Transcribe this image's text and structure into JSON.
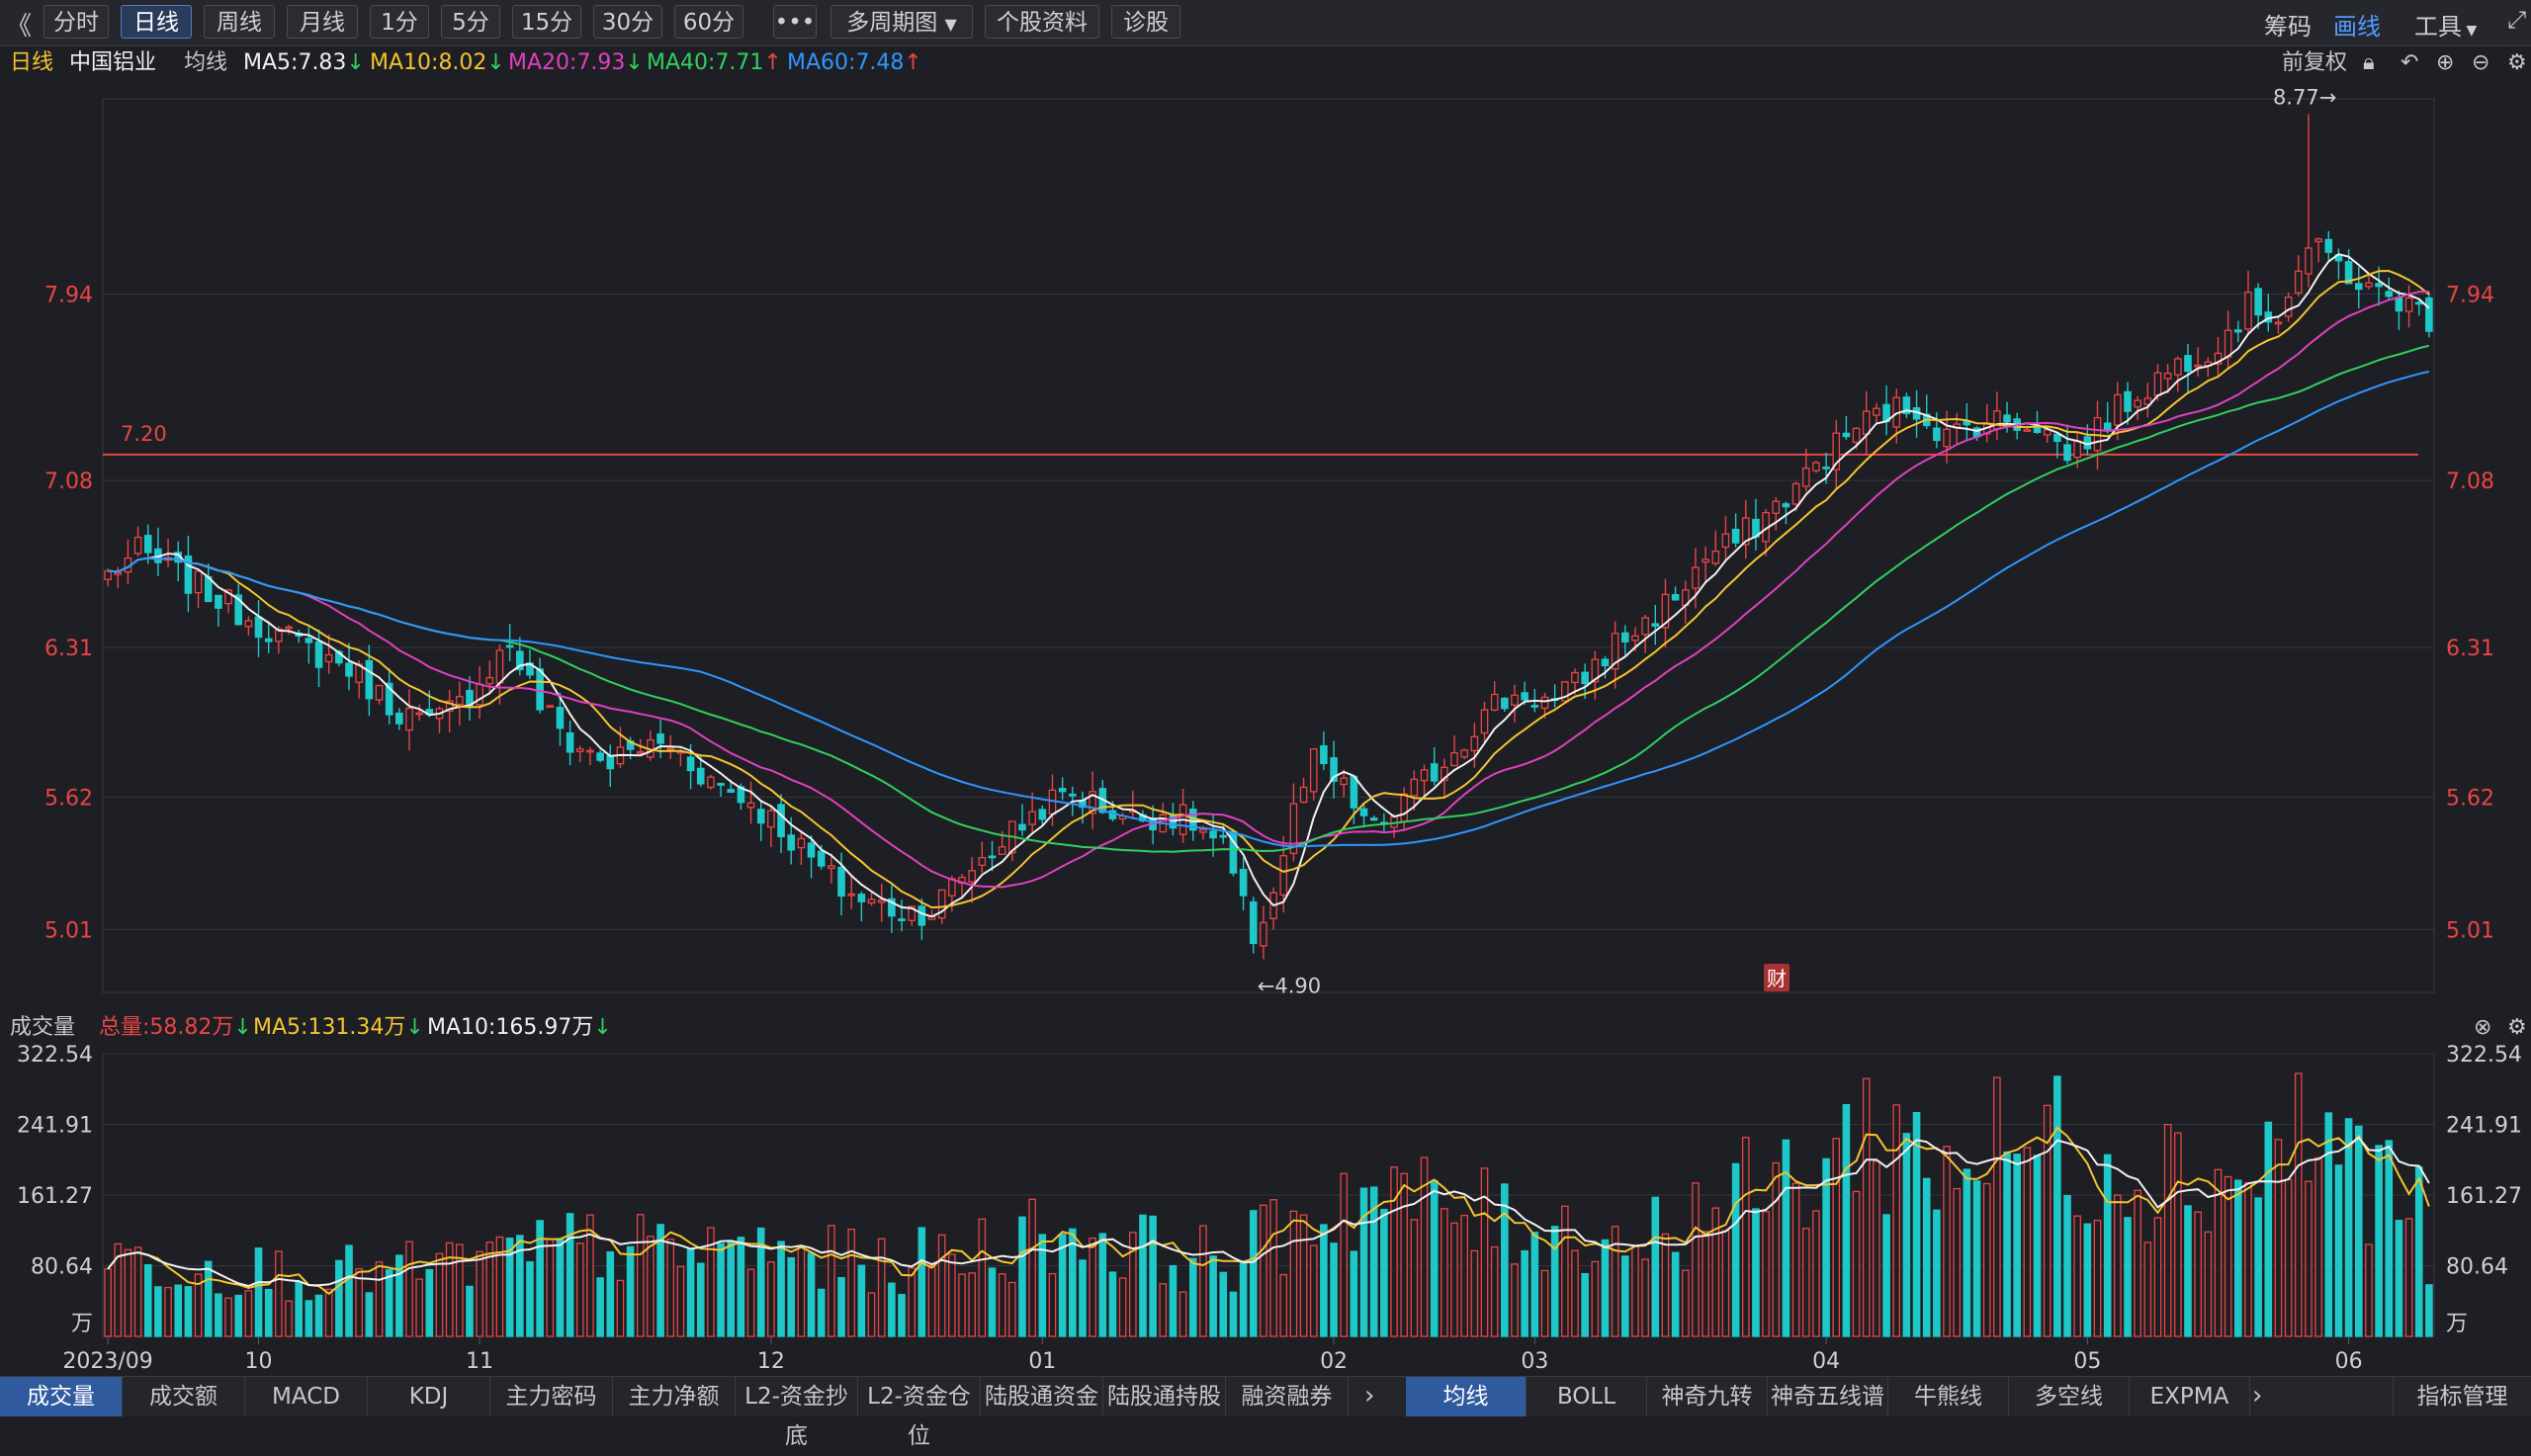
{
  "toolbar": {
    "back_icon": "double-chevron-left-icon",
    "periods": [
      "分时",
      "日线",
      "周线",
      "月线",
      "1分",
      "5分",
      "15分",
      "30分",
      "60分"
    ],
    "active_period": "日线",
    "more_label": "•••",
    "multi_period": "多周期图",
    "stock_info": "个股资料",
    "diagnose": "诊股",
    "right_items": [
      "筹码",
      "画线",
      "工具"
    ],
    "right_active": "画线",
    "expand_icon": "expand-icon"
  },
  "legend": {
    "period": "日线",
    "stock": "中国铝业",
    "ma_label": "均线",
    "ma_items": [
      {
        "text": "MA5:7.83",
        "dir": "down",
        "color": "#f0f0f0"
      },
      {
        "text": "MA10:8.02",
        "dir": "down",
        "color": "#f4c430"
      },
      {
        "text": "MA20:7.93",
        "dir": "down",
        "color": "#e040c0"
      },
      {
        "text": "MA40:7.71",
        "dir": "up",
        "color": "#30d060"
      },
      {
        "text": "MA60:7.48",
        "dir": "up",
        "color": "#2f96ff"
      }
    ],
    "adjust": "前复权",
    "lock_icon": "lock-icon",
    "undo_icon": "undo-icon",
    "zoom_in_icon": "zoom-in-icon",
    "zoom_out_icon": "zoom-out-icon",
    "settings_icon": "gear-icon"
  },
  "vol_legend": {
    "name": "成交量",
    "total": "总量:58.82万",
    "ma5": "MA5:131.34万",
    "ma10": "MA10:165.97万",
    "close_icon": "close-icon",
    "settings_icon": "gear-icon"
  },
  "annotations": {
    "high": "8.77→",
    "low": "←4.90",
    "hline": "7.20",
    "fin_badge": "财"
  },
  "colors": {
    "up": "#e84545",
    "down": "#1fc8c8",
    "ma5": "#f0f0f0",
    "ma10": "#f4c430",
    "ma20": "#e040c0",
    "ma40": "#30d060",
    "ma60": "#2f96ff",
    "hline": "#e84545"
  },
  "bottom_tabs_left": [
    "成交量",
    "成交额",
    "MACD",
    "KDJ",
    "主力密码",
    "主力净额",
    "L2-资金抄底",
    "L2-资金仓位",
    "陆股通资金",
    "陆股通持股",
    "融资融券"
  ],
  "bottom_tabs_right": [
    "均线",
    "BOLL",
    "神奇九转",
    "神奇五线谱",
    "牛熊线",
    "多空线",
    "EXPMA"
  ],
  "bottom_more_icon": "chevron-right-icon",
  "indicator_manage": "指标管理",
  "chart_data": [
    {
      "type": "candlestick",
      "title": "中国铝业 日线",
      "y_ticks": [
        "7.94",
        "7.08",
        "6.31",
        "5.62",
        "5.01"
      ],
      "ylim": [
        4.72,
        8.84
      ],
      "x_ticks": [
        "2023/09",
        "10",
        "11",
        "12",
        "01",
        "02",
        "03",
        "04",
        "05",
        "06"
      ],
      "x_tick_index": [
        0,
        15,
        37,
        66,
        93,
        122,
        142,
        171,
        197,
        223
      ],
      "grid": true,
      "horizontal_line": 7.2,
      "high_mark": {
        "value": 8.77,
        "index": 219
      },
      "low_mark": {
        "value": 4.9,
        "index": 114
      },
      "keypoints": [
        [
          0,
          6.65
        ],
        [
          3,
          6.75
        ],
        [
          8,
          6.62
        ],
        [
          14,
          6.45
        ],
        [
          19,
          6.32
        ],
        [
          24,
          6.22
        ],
        [
          28,
          6.05
        ],
        [
          32,
          5.95
        ],
        [
          35,
          6.05
        ],
        [
          38,
          6.22
        ],
        [
          40,
          6.33
        ],
        [
          43,
          6.05
        ],
        [
          46,
          5.87
        ],
        [
          50,
          5.78
        ],
        [
          53,
          5.85
        ],
        [
          56,
          5.86
        ],
        [
          60,
          5.7
        ],
        [
          64,
          5.6
        ],
        [
          67,
          5.48
        ],
        [
          70,
          5.33
        ],
        [
          73,
          5.2
        ],
        [
          76,
          5.13
        ],
        [
          79,
          5.1
        ],
        [
          82,
          5.1
        ],
        [
          85,
          5.26
        ],
        [
          89,
          5.42
        ],
        [
          93,
          5.58
        ],
        [
          96,
          5.64
        ],
        [
          99,
          5.58
        ],
        [
          102,
          5.52
        ],
        [
          105,
          5.55
        ],
        [
          108,
          5.5
        ],
        [
          111,
          5.38
        ],
        [
          113,
          5.1
        ],
        [
          114,
          4.98
        ],
        [
          116,
          5.18
        ],
        [
          118,
          5.55
        ],
        [
          120,
          5.78
        ],
        [
          123,
          5.65
        ],
        [
          126,
          5.46
        ],
        [
          129,
          5.6
        ],
        [
          132,
          5.74
        ],
        [
          135,
          5.9
        ],
        [
          138,
          6.05
        ],
        [
          141,
          6.1
        ],
        [
          144,
          6.05
        ],
        [
          147,
          6.18
        ],
        [
          150,
          6.33
        ],
        [
          153,
          6.42
        ],
        [
          156,
          6.55
        ],
        [
          159,
          6.72
        ],
        [
          162,
          6.8
        ],
        [
          165,
          6.92
        ],
        [
          168,
          7.05
        ],
        [
          171,
          7.2
        ],
        [
          174,
          7.33
        ],
        [
          177,
          7.4
        ],
        [
          180,
          7.42
        ],
        [
          183,
          7.28
        ],
        [
          186,
          7.35
        ],
        [
          189,
          7.36
        ],
        [
          192,
          7.35
        ],
        [
          195,
          7.2
        ],
        [
          198,
          7.32
        ],
        [
          201,
          7.45
        ],
        [
          204,
          7.55
        ],
        [
          207,
          7.65
        ],
        [
          210,
          7.72
        ],
        [
          213,
          7.88
        ],
        [
          216,
          7.85
        ],
        [
          219,
          8.15
        ],
        [
          222,
          8.08
        ],
        [
          225,
          7.95
        ],
        [
          228,
          7.92
        ],
        [
          231,
          7.83
        ]
      ],
      "n_bars": 232,
      "ma_series": [
        {
          "name": "MA5",
          "last": 7.83
        },
        {
          "name": "MA10",
          "last": 8.02
        },
        {
          "name": "MA20",
          "last": 7.93
        },
        {
          "name": "MA40",
          "last": 7.71
        },
        {
          "name": "MA60",
          "last": 7.48
        }
      ]
    },
    {
      "type": "bar",
      "title": "成交量",
      "y_ticks": [
        "322.54",
        "241.91",
        "161.27",
        "80.64"
      ],
      "unit": "万",
      "ylim": [
        0,
        322.54
      ],
      "series_ma": [
        "MA5",
        "MA10"
      ],
      "keypoints": [
        [
          0,
          90
        ],
        [
          10,
          80
        ],
        [
          20,
          70
        ],
        [
          30,
          75
        ],
        [
          40,
          90
        ],
        [
          48,
          105
        ],
        [
          55,
          95
        ],
        [
          62,
          100
        ],
        [
          70,
          90
        ],
        [
          78,
          80
        ],
        [
          85,
          95
        ],
        [
          90,
          110
        ],
        [
          96,
          120
        ],
        [
          105,
          95
        ],
        [
          112,
          85
        ],
        [
          118,
          130
        ],
        [
          124,
          165
        ],
        [
          130,
          150
        ],
        [
          138,
          130
        ],
        [
          146,
          120
        ],
        [
          152,
          110
        ],
        [
          158,
          140
        ],
        [
          164,
          160
        ],
        [
          170,
          190
        ],
        [
          176,
          240
        ],
        [
          182,
          200
        ],
        [
          188,
          210
        ],
        [
          194,
          220
        ],
        [
          200,
          200
        ],
        [
          206,
          190
        ],
        [
          212,
          180
        ],
        [
          218,
          230
        ],
        [
          224,
          200
        ],
        [
          228,
          160
        ],
        [
          231,
          130
        ]
      ],
      "last_value": 58.82
    }
  ]
}
